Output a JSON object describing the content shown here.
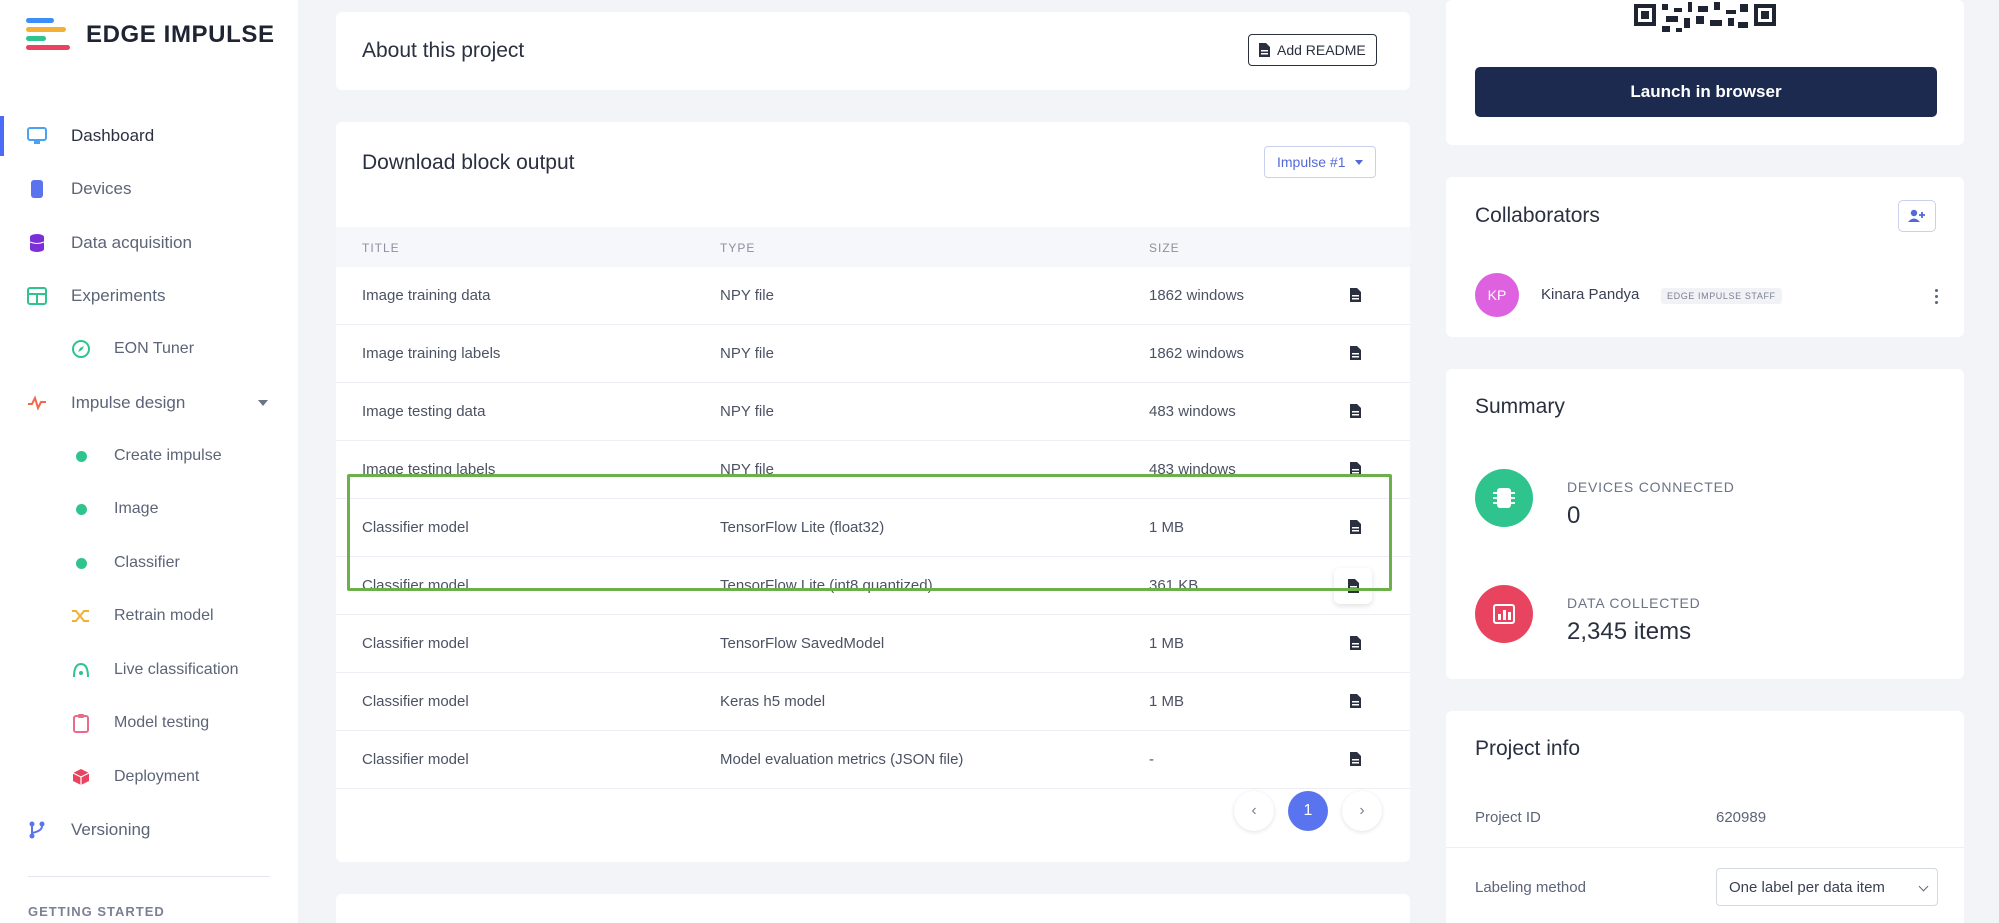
{
  "app": {
    "logo_text": "EDGE IMPULSE"
  },
  "sidebar": {
    "items": [
      {
        "label": "Dashboard",
        "icon": "monitor-icon"
      },
      {
        "label": "Devices",
        "icon": "device-icon"
      },
      {
        "label": "Data acquisition",
        "icon": "database-icon"
      },
      {
        "label": "Experiments",
        "icon": "table-icon"
      },
      {
        "label": "EON Tuner",
        "icon": "compass-icon"
      },
      {
        "label": "Impulse design",
        "icon": "pulse-icon"
      },
      {
        "label": "Create impulse",
        "icon": "dot-icon"
      },
      {
        "label": "Image",
        "icon": "dot-icon"
      },
      {
        "label": "Classifier",
        "icon": "dot-icon"
      },
      {
        "label": "Retrain model",
        "icon": "shuffle-icon"
      },
      {
        "label": "Live classification",
        "icon": "signal-icon"
      },
      {
        "label": "Model testing",
        "icon": "clipboard-icon"
      },
      {
        "label": "Deployment",
        "icon": "package-icon"
      },
      {
        "label": "Versioning",
        "icon": "branch-icon"
      }
    ],
    "section_label": "GETTING STARTED"
  },
  "about": {
    "title": "About this project",
    "add_readme_label": "Add README"
  },
  "download": {
    "title": "Download block output",
    "impulse_select": "Impulse #1",
    "columns": {
      "title": "TITLE",
      "type": "TYPE",
      "size": "SIZE"
    },
    "rows": [
      {
        "title": "Image training data",
        "type": "NPY file",
        "size": "1862 windows"
      },
      {
        "title": "Image training labels",
        "type": "NPY file",
        "size": "1862 windows"
      },
      {
        "title": "Image testing data",
        "type": "NPY file",
        "size": "483 windows"
      },
      {
        "title": "Image testing labels",
        "type": "NPY file",
        "size": "483 windows"
      },
      {
        "title": "Classifier model",
        "type": "TensorFlow Lite (float32)",
        "size": "1 MB"
      },
      {
        "title": "Classifier model",
        "type": "TensorFlow Lite (int8 quantized)",
        "size": "361 KB"
      },
      {
        "title": "Classifier model",
        "type": "TensorFlow SavedModel",
        "size": "1 MB"
      },
      {
        "title": "Classifier model",
        "type": "Keras h5 model",
        "size": "1 MB"
      },
      {
        "title": "Classifier model",
        "type": "Model evaluation metrics (JSON file)",
        "size": "-"
      }
    ],
    "pagination": {
      "prev": "‹",
      "current": "1",
      "next": "›"
    }
  },
  "launch": {
    "label": "Launch in browser"
  },
  "collaborators": {
    "title": "Collaborators",
    "items": [
      {
        "initials": "KP",
        "name": "Kinara Pandya",
        "badge": "EDGE IMPULSE STAFF"
      }
    ]
  },
  "summary": {
    "title": "Summary",
    "stats": [
      {
        "label": "DEVICES CONNECTED",
        "value": "0",
        "color": "#2fc48d"
      },
      {
        "label": "DATA COLLECTED",
        "value": "2,345 items",
        "color": "#e8445f"
      }
    ]
  },
  "project_info": {
    "title": "Project info",
    "project_id_label": "Project ID",
    "project_id_value": "620989",
    "labeling_label": "Labeling method",
    "labeling_value": "One label per data item"
  },
  "colors": {
    "accent": "#4a6cf7",
    "primary_dark": "#1b2a4e",
    "highlight_green": "#6bb04a"
  }
}
